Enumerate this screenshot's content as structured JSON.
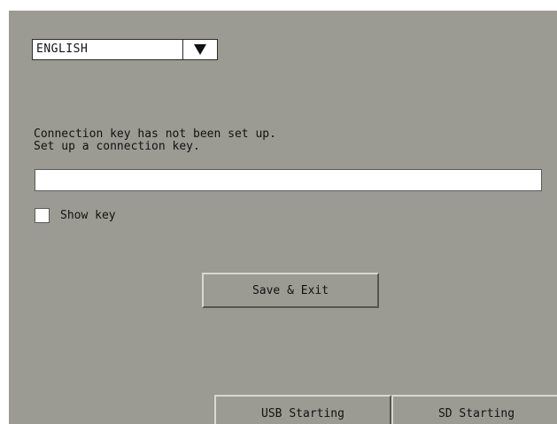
{
  "language": {
    "selected": "ENGLISH",
    "arrow_icon": "triangle-down-icon"
  },
  "message": {
    "line1": "Connection key has not been set up.",
    "line2": "Set up a connection key."
  },
  "key_input": {
    "value": "",
    "placeholder": ""
  },
  "show_key": {
    "label": "Show key",
    "checked": false
  },
  "buttons": {
    "save_exit": "Save & Exit",
    "usb_starting": "USB Starting",
    "sd_starting": "SD Starting"
  },
  "colors": {
    "panel_background": "#9c9b93",
    "field_background": "#ffffff"
  }
}
